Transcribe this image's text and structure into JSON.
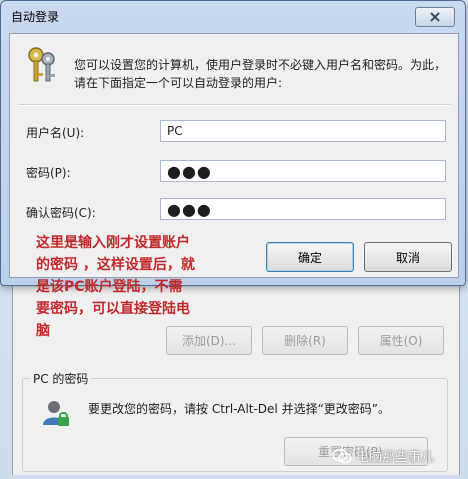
{
  "dialog": {
    "title": "自动登录",
    "description_line1": "您可以设置您的计算机，使用户登录时不必键入用户名和密码。为此，",
    "description_line2": "请在下面指定一个可以自动登录的用户:",
    "username_label": "用户名(U):",
    "username_value": "PC",
    "password_label": "密码(P):",
    "password_value": "●●●",
    "confirm_label": "确认密码(C):",
    "confirm_value": "●●●",
    "ok_label": "确定",
    "cancel_label": "取消"
  },
  "annotation": {
    "line1": "这里是输入刚才设置账户",
    "line2": "的密码 ，这样设置后，就",
    "line3": "是该PC账户登陆，不需",
    "line4": "要密码，可以直接登陆电",
    "line5": "脑"
  },
  "background": {
    "add_label": "添加(D)...",
    "delete_label": "删除(R)",
    "properties_label": "属性(O)",
    "group_title": "PC 的密码",
    "password_hint": "要更改您的密码，请按 Ctrl-Alt-Del 并选择“更改密码”。",
    "reset_label": "重置密码(P)..."
  },
  "watermark": "电脑那些事儿",
  "icons": {
    "dialog_icon": "keys-icon",
    "close_icon": "close-icon",
    "password_icon": "user-icon"
  },
  "colors": {
    "annotation": "#c0282a",
    "titlebar": "#c9d9ee"
  }
}
